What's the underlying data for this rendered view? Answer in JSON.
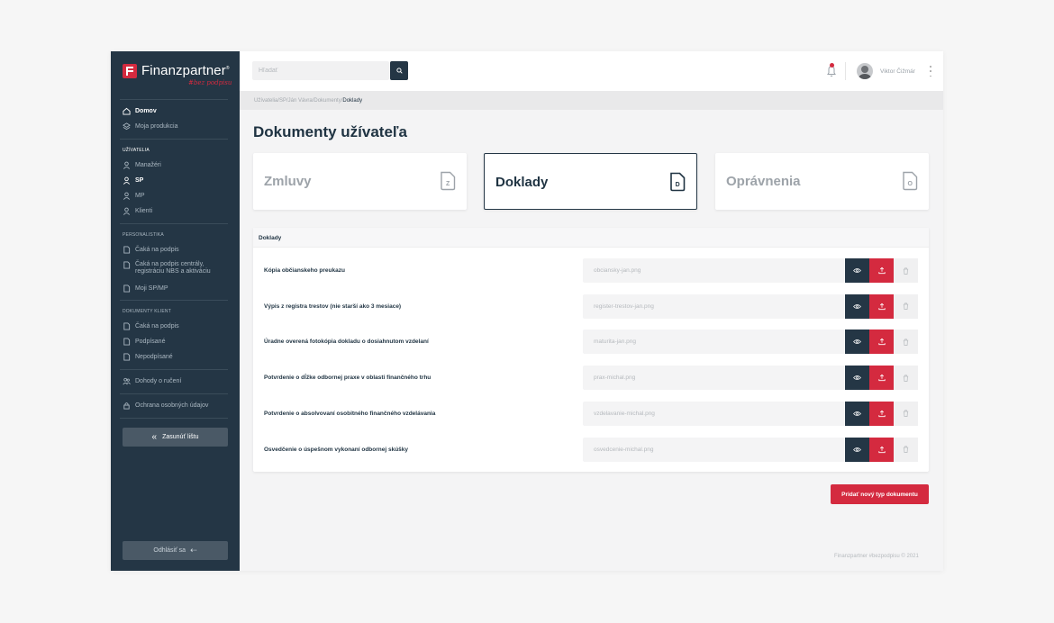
{
  "brand": {
    "name": "Finanzpartner",
    "trademark": "®",
    "tagline": "#bez podpisu",
    "accent": "#d42a3f",
    "dark": "#243645"
  },
  "sidebar": {
    "top_items": [
      {
        "label": "Domov",
        "icon": "home-icon",
        "active": true
      },
      {
        "label": "Moja produkcia",
        "icon": "layers-icon",
        "active": false
      }
    ],
    "sections": [
      {
        "title": "UŽÍVATELIA",
        "items": [
          {
            "label": "Manažéri",
            "icon": "user-icon"
          },
          {
            "label": "SP",
            "icon": "user-icon"
          },
          {
            "label": "MP",
            "icon": "user-icon"
          },
          {
            "label": "Klienti",
            "icon": "user-icon"
          }
        ]
      },
      {
        "title": "PERSONALISTIKA",
        "items": [
          {
            "label": "Čaká na podpis",
            "icon": "document-icon"
          },
          {
            "label": "Čaká na podpis centrály, registráciu NBS a aktiváciu",
            "icon": "document-icon"
          },
          {
            "label": "Moji SP/MP",
            "icon": "document-icon"
          }
        ]
      },
      {
        "title": "DOKUMENTY KLIENT",
        "items": [
          {
            "label": "Čaká na podpis",
            "icon": "document-icon"
          },
          {
            "label": "Podpísané",
            "icon": "document-icon"
          },
          {
            "label": "Nepodpísané",
            "icon": "document-icon"
          }
        ]
      }
    ],
    "agreements": "Dohody o ručení",
    "privacy": "Ochrana osobných údajov",
    "collapse_label": "Zasunúť lištu",
    "logout_label": "Odhlásiť sa"
  },
  "topbar": {
    "search_placeholder": "Hľadať",
    "user_name": "Viktor Čižmár"
  },
  "breadcrumb": {
    "path": "Užívatelia/SP/Ján Vávra/Dokumenty/",
    "current": "Doklady"
  },
  "page_title": "Dokumenty užívateľa",
  "cards": [
    {
      "label": "Zmluvy",
      "icon_letter": "Z",
      "active": false
    },
    {
      "label": "Doklady",
      "icon_letter": "D",
      "active": true
    },
    {
      "label": "Oprávnenia",
      "icon_letter": "O",
      "active": false
    }
  ],
  "panel": {
    "title": "Doklady",
    "rows": [
      {
        "label": "Kópia občianskeho preukazu",
        "file": "obciansky-jan.png"
      },
      {
        "label": "Výpis z registra trestov (nie starší ako 3 mesiace)",
        "file": "register-trestov-jan.png"
      },
      {
        "label": "Úradne overená fotokópia dokladu o dosiahnutom vzdelaní",
        "file": "maturita-jan.png"
      },
      {
        "label": "Potvrdenie o dĺžke odbornej praxe v oblasti finančného trhu",
        "file": "prax-michal.png"
      },
      {
        "label": "Potvrdenie o absolvovaní osobitného finančného vzdelávania",
        "file": "vzdelavanie-michal.png"
      },
      {
        "label": "Osvedčenie o úspešnom vykonaní odbornej skúšky",
        "file": "osvedcenie-michal.png"
      }
    ]
  },
  "add_button": "Pridať nový typ dokumentu",
  "footer": "Finanzpartner #bezpodpisu © 2021"
}
